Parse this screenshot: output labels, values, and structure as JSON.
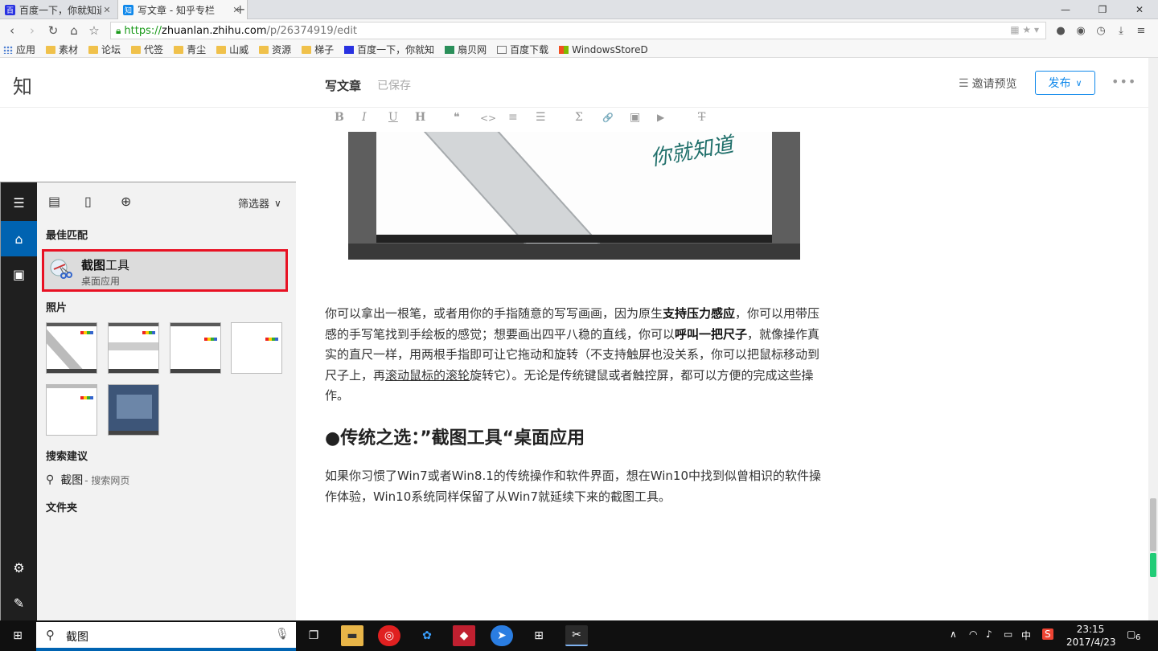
{
  "browser": {
    "tabs": [
      {
        "title": "百度一下，你就知道",
        "close": "✕",
        "active": false
      },
      {
        "title": "写文章 - 知乎专栏",
        "close": "✕",
        "active": true
      }
    ],
    "new_tab": "+",
    "window_controls": [
      "—",
      "❐",
      "✕"
    ],
    "url_scheme": "https://",
    "url_host": "zhuanlan.zhihu.com",
    "url_path": "/p/26374919/edit",
    "bookmarks": [
      "应用",
      "素材",
      "论坛",
      "代签",
      "青尘",
      "山威",
      "资源",
      "梯子",
      "百度一下，你就知",
      "扇贝网",
      "百度下载",
      "WindowsStoreD"
    ]
  },
  "editor": {
    "logo": "知",
    "title": "写文章",
    "saved": "已保存",
    "invite": "邀请预览",
    "publish": "发布",
    "more": "•••",
    "toolbar": [
      "B",
      "I",
      "U",
      "H",
      "❝",
      "<>",
      "≡",
      "☰",
      "Σ",
      "🔗",
      "▣",
      "▶",
      "T"
    ],
    "image_handwriting": "你就知道",
    "para1": [
      {
        "t": "你可以拿出一根笔，或者用你的手指随意的写写画画，因为原生",
        "s": ""
      },
      {
        "t": "支持压力感应",
        "s": "b"
      },
      {
        "t": "，你可以用带压感的手写笔找到手绘板的感觉；想要画出四平八稳的直线，你可以",
        "s": ""
      },
      {
        "t": "呼叫一把尺子",
        "s": "b"
      },
      {
        "t": "，就像操作真实的直尺一样，用两根手指即可让它拖动和旋转（不支持触屏也没关系，你可以把鼠标移动到尺子上，再",
        "s": ""
      },
      {
        "t": "滚动鼠标的滚轮",
        "s": "u"
      },
      {
        "t": "旋转它）。无论是传统键鼠或者触控屏，都可以方便的完成这些操作。",
        "s": ""
      }
    ],
    "heading": "●传统之选：”截图工具“桌面应用",
    "para2": "如果你习惯了Win7或者Win8.1的传统操作和软件界面，想在Win10中找到似曾相识的软件操作体验，Win10系统同样保留了从Win7就延续下来的截图工具。"
  },
  "start_menu": {
    "filter": "筛选器",
    "best_match_label": "最佳匹配",
    "best_match": {
      "name_bold": "截图",
      "name_rest": "工具",
      "type": "桌面应用"
    },
    "photos_label": "照片",
    "suggest_label": "搜索建议",
    "suggestion": {
      "text": "截图",
      "hint": " - 搜索网页"
    },
    "folders_label": "文件夹",
    "search_query": "截图"
  },
  "taskbar": {
    "time": "23:15",
    "date": "2017/4/23",
    "ime": "中",
    "notifications": "6"
  },
  "colors": {
    "accent": "#0063b1",
    "highlight_border": "#e81123",
    "zhihu_blue": "#0f88eb"
  }
}
